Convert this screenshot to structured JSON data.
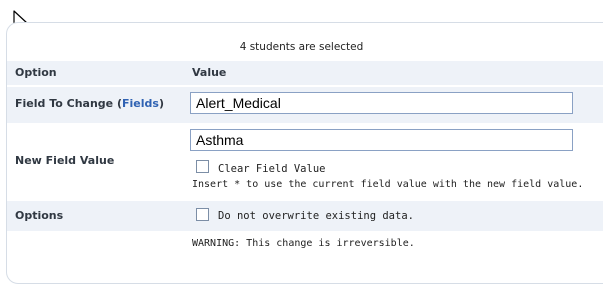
{
  "cursor": {
    "icon": "arrow-cursor-icon"
  },
  "selection": {
    "text": "4 students are selected"
  },
  "table": {
    "col_option": "Option",
    "col_value": "Value"
  },
  "field_to_change": {
    "label_prefix": "Field To Change (",
    "link_text": "Fields",
    "label_suffix": ")",
    "value": "Alert_Medical"
  },
  "new_field_value": {
    "label": "New Field Value",
    "value": "Asthma",
    "clear_label": "Clear Field Value",
    "clear_checked": false,
    "hint": "Insert * to use the current field value with the new field value."
  },
  "options": {
    "label": "Options",
    "no_overwrite_label": "Do not overwrite existing data.",
    "no_overwrite_checked": false
  },
  "warning": {
    "text": "WARNING: This change is irreversible."
  },
  "colors": {
    "link": "#2f62b3",
    "row_shade": "#eef2f8",
    "input_border": "#8aa1c4"
  }
}
